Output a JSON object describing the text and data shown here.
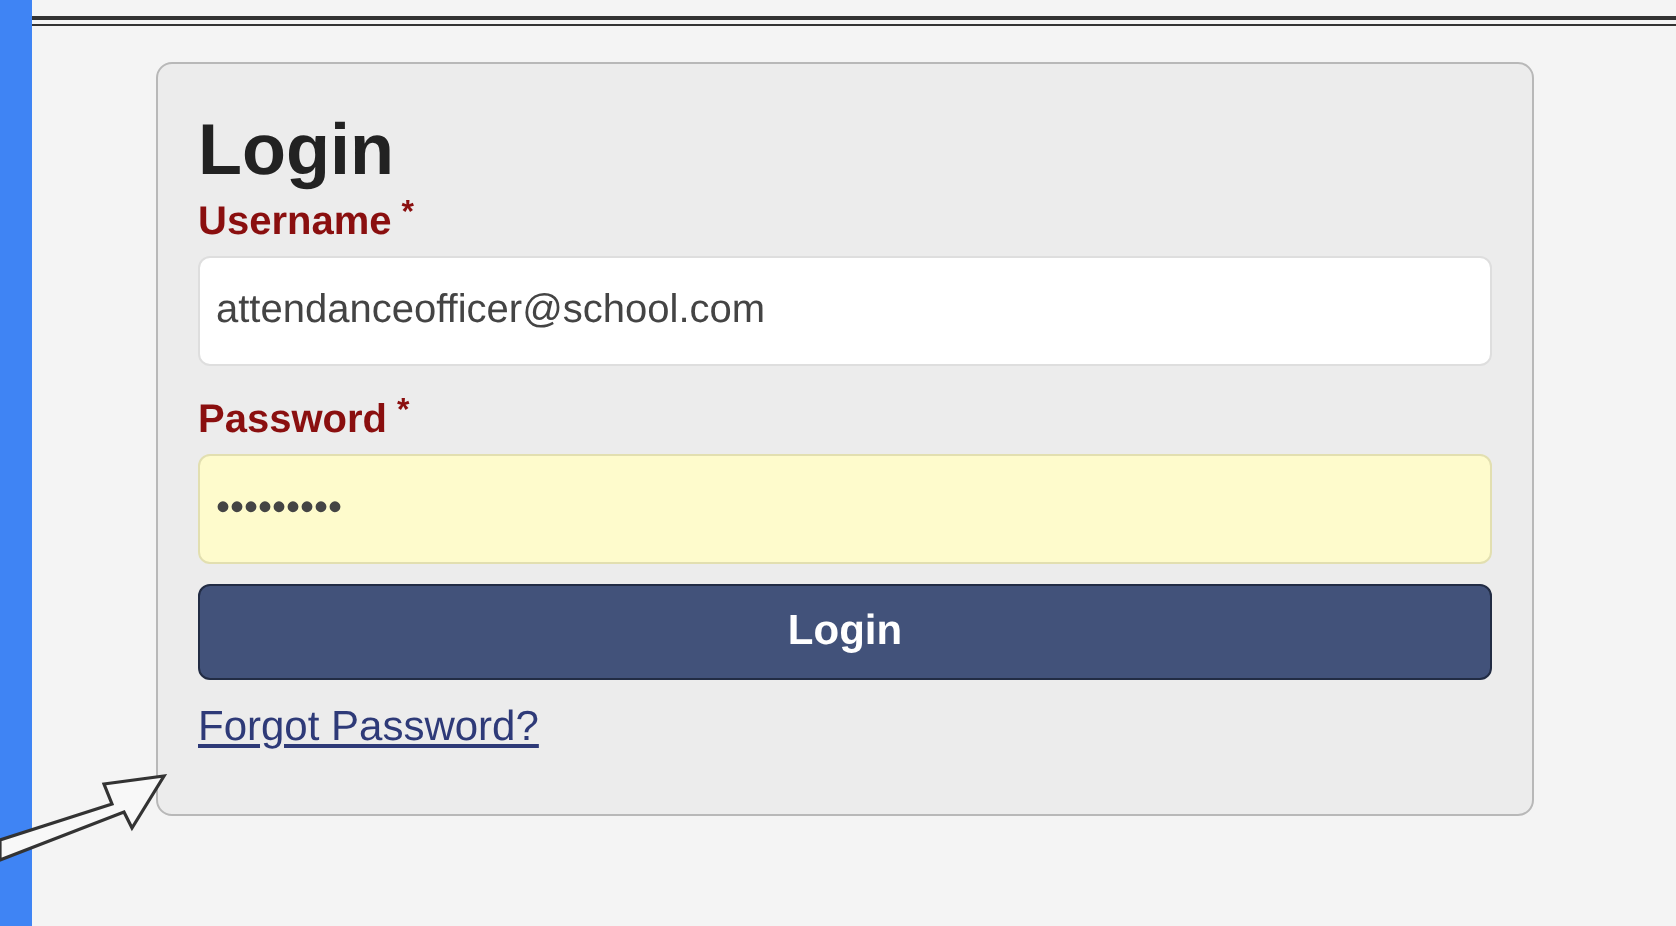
{
  "login_form": {
    "title": "Login",
    "fields": [
      {
        "label": "Username",
        "required_mark": "*",
        "value": "attendanceofficer@school.com",
        "highlighted": false
      },
      {
        "label": "Password",
        "required_mark": "*",
        "value": "•••••••••",
        "highlighted": true
      }
    ],
    "submit_button": "Login",
    "forgot_link": "Forgot Password?"
  }
}
